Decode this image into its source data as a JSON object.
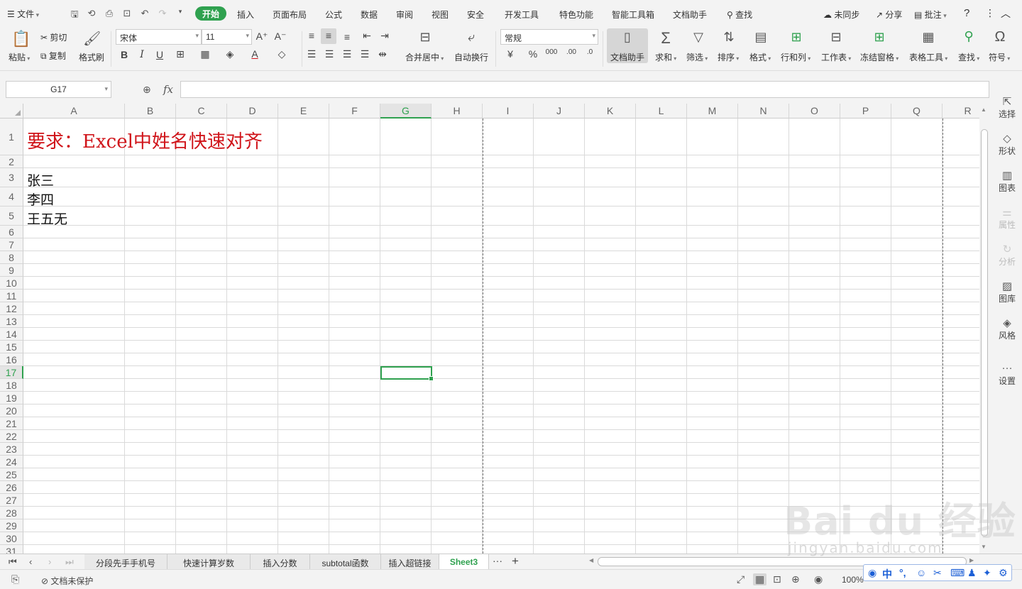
{
  "menubar": {
    "file_label": "文件",
    "tabs": [
      "开始",
      "插入",
      "页面布局",
      "公式",
      "数据",
      "审阅",
      "视图",
      "安全",
      "开发工具",
      "特色功能",
      "智能工具箱",
      "文档助手"
    ],
    "search_label": "查找",
    "unsync_label": "未同步",
    "share_label": "分享",
    "comment_label": "批注"
  },
  "ribbon": {
    "paste_label": "粘贴",
    "cut_label": "剪切",
    "copy_label": "复制",
    "format_painter_label": "格式刷",
    "font_name": "宋体",
    "font_size": "11",
    "merge_label": "合并居中",
    "wrap_label": "自动换行",
    "number_format": "常规",
    "doc_assistant_label": "文档助手",
    "sum_label": "求和",
    "filter_label": "筛选",
    "sort_label": "排序",
    "format_label": "格式",
    "row_col_label": "行和列",
    "worksheet_label": "工作表",
    "freeze_label": "冻结窗格",
    "table_tools_label": "表格工具",
    "find_label": "查找",
    "symbol_label": "符号"
  },
  "formula_bar": {
    "name_box": "G17",
    "fx_label": "fx",
    "formula": ""
  },
  "sidepane": [
    {
      "label": "选择",
      "icon": "cursor-icon",
      "disabled": false
    },
    {
      "label": "形状",
      "icon": "shape-icon",
      "disabled": false
    },
    {
      "label": "图表",
      "icon": "chart-icon",
      "disabled": false
    },
    {
      "label": "属性",
      "icon": "properties-icon",
      "disabled": true
    },
    {
      "label": "分析",
      "icon": "analysis-icon",
      "disabled": true
    },
    {
      "label": "图库",
      "icon": "gallery-icon",
      "disabled": false
    },
    {
      "label": "风格",
      "icon": "style-icon",
      "disabled": false
    },
    {
      "label": "设置",
      "icon": "more-icon",
      "disabled": false
    }
  ],
  "grid": {
    "columns": [
      "A",
      "B",
      "C",
      "D",
      "E",
      "F",
      "G",
      "H",
      "I",
      "J",
      "K",
      "L",
      "M",
      "N",
      "O",
      "P",
      "Q",
      "R"
    ],
    "selected_column": "G",
    "selected_row": 17,
    "row_count": 31,
    "cells": {
      "A1": "要求：Excel中姓名快速对齐",
      "A3": "张三",
      "A4": "李四",
      "A5": "王五无"
    },
    "accent_color": "#2fa14f",
    "title_color": "#d0141a"
  },
  "sheet_tabs": {
    "tabs": [
      "分段先手手机号",
      "快速计算岁数",
      "插入分数",
      "subtotal函数",
      "插入超链接",
      "Sheet3"
    ],
    "active": "Sheet3",
    "more_label": "···",
    "add_label": "+"
  },
  "statusbar": {
    "protect_label": "文档未保护",
    "zoom_label": "100%"
  },
  "watermark": {
    "text": "Bai du 经验",
    "sub": "jingyan.baidu.com"
  },
  "ime": {
    "mode_label": "中"
  }
}
